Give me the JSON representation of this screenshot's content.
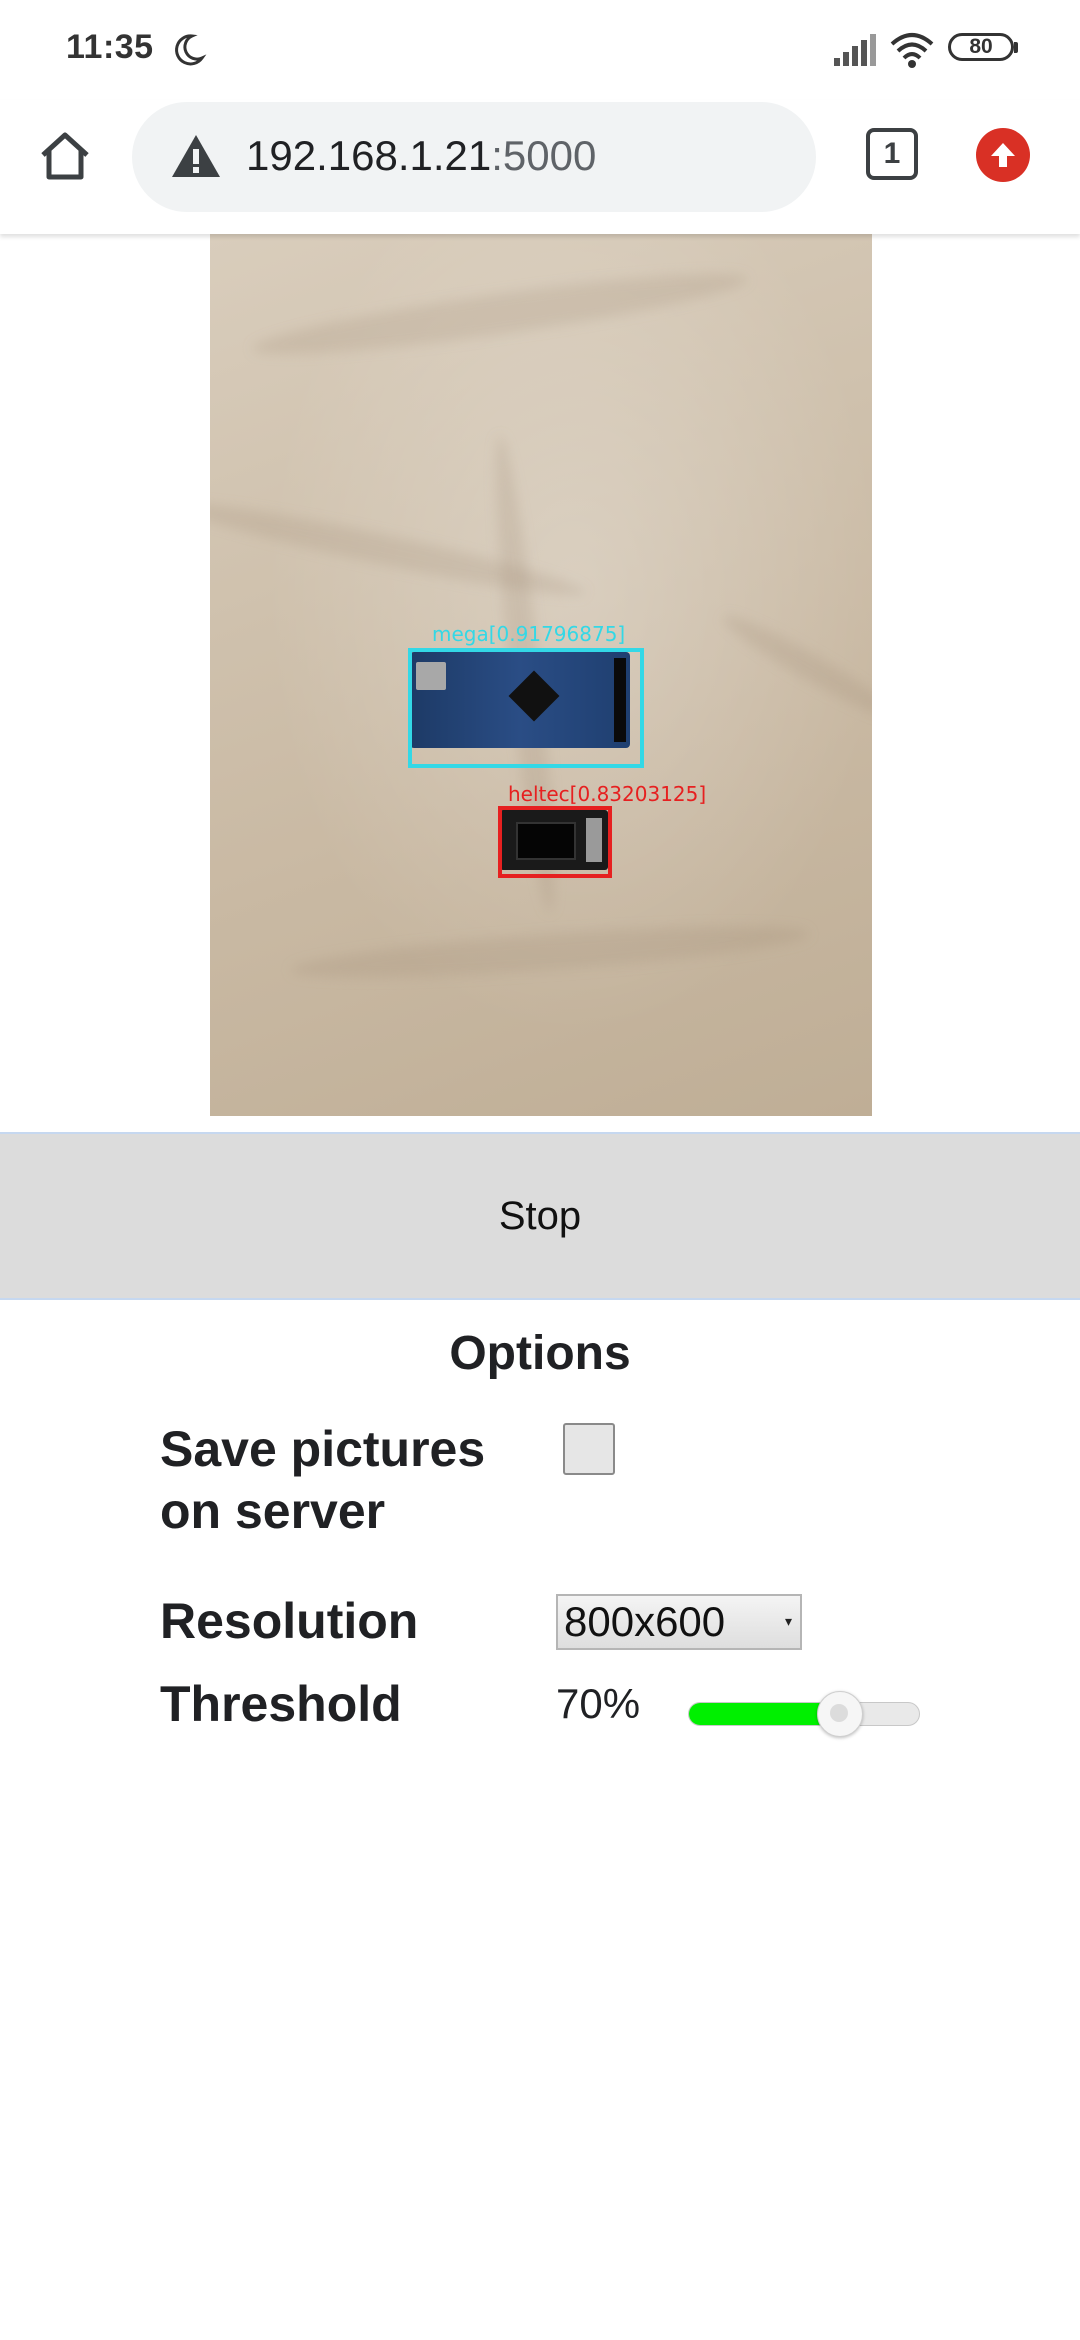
{
  "status_bar": {
    "time": "11:35",
    "battery": "80"
  },
  "browser": {
    "url_host": "192.168.1.21",
    "url_port": ":5000",
    "tab_count": "1"
  },
  "camera": {
    "detections": [
      {
        "label": "mega[0.91796875]",
        "color": "#33d8e6"
      },
      {
        "label": "heltec[0.83203125]",
        "color": "#e62020"
      }
    ]
  },
  "controls": {
    "stop_label": "Stop"
  },
  "options": {
    "title": "Options",
    "save_pictures_label": "Save pictures on server",
    "save_pictures_checked": false,
    "resolution_label": "Resolution",
    "resolution_value": "800x600",
    "threshold_label": "Threshold",
    "threshold_value": "70%",
    "threshold_fraction": 0.65,
    "slider_color": "#00f000"
  }
}
